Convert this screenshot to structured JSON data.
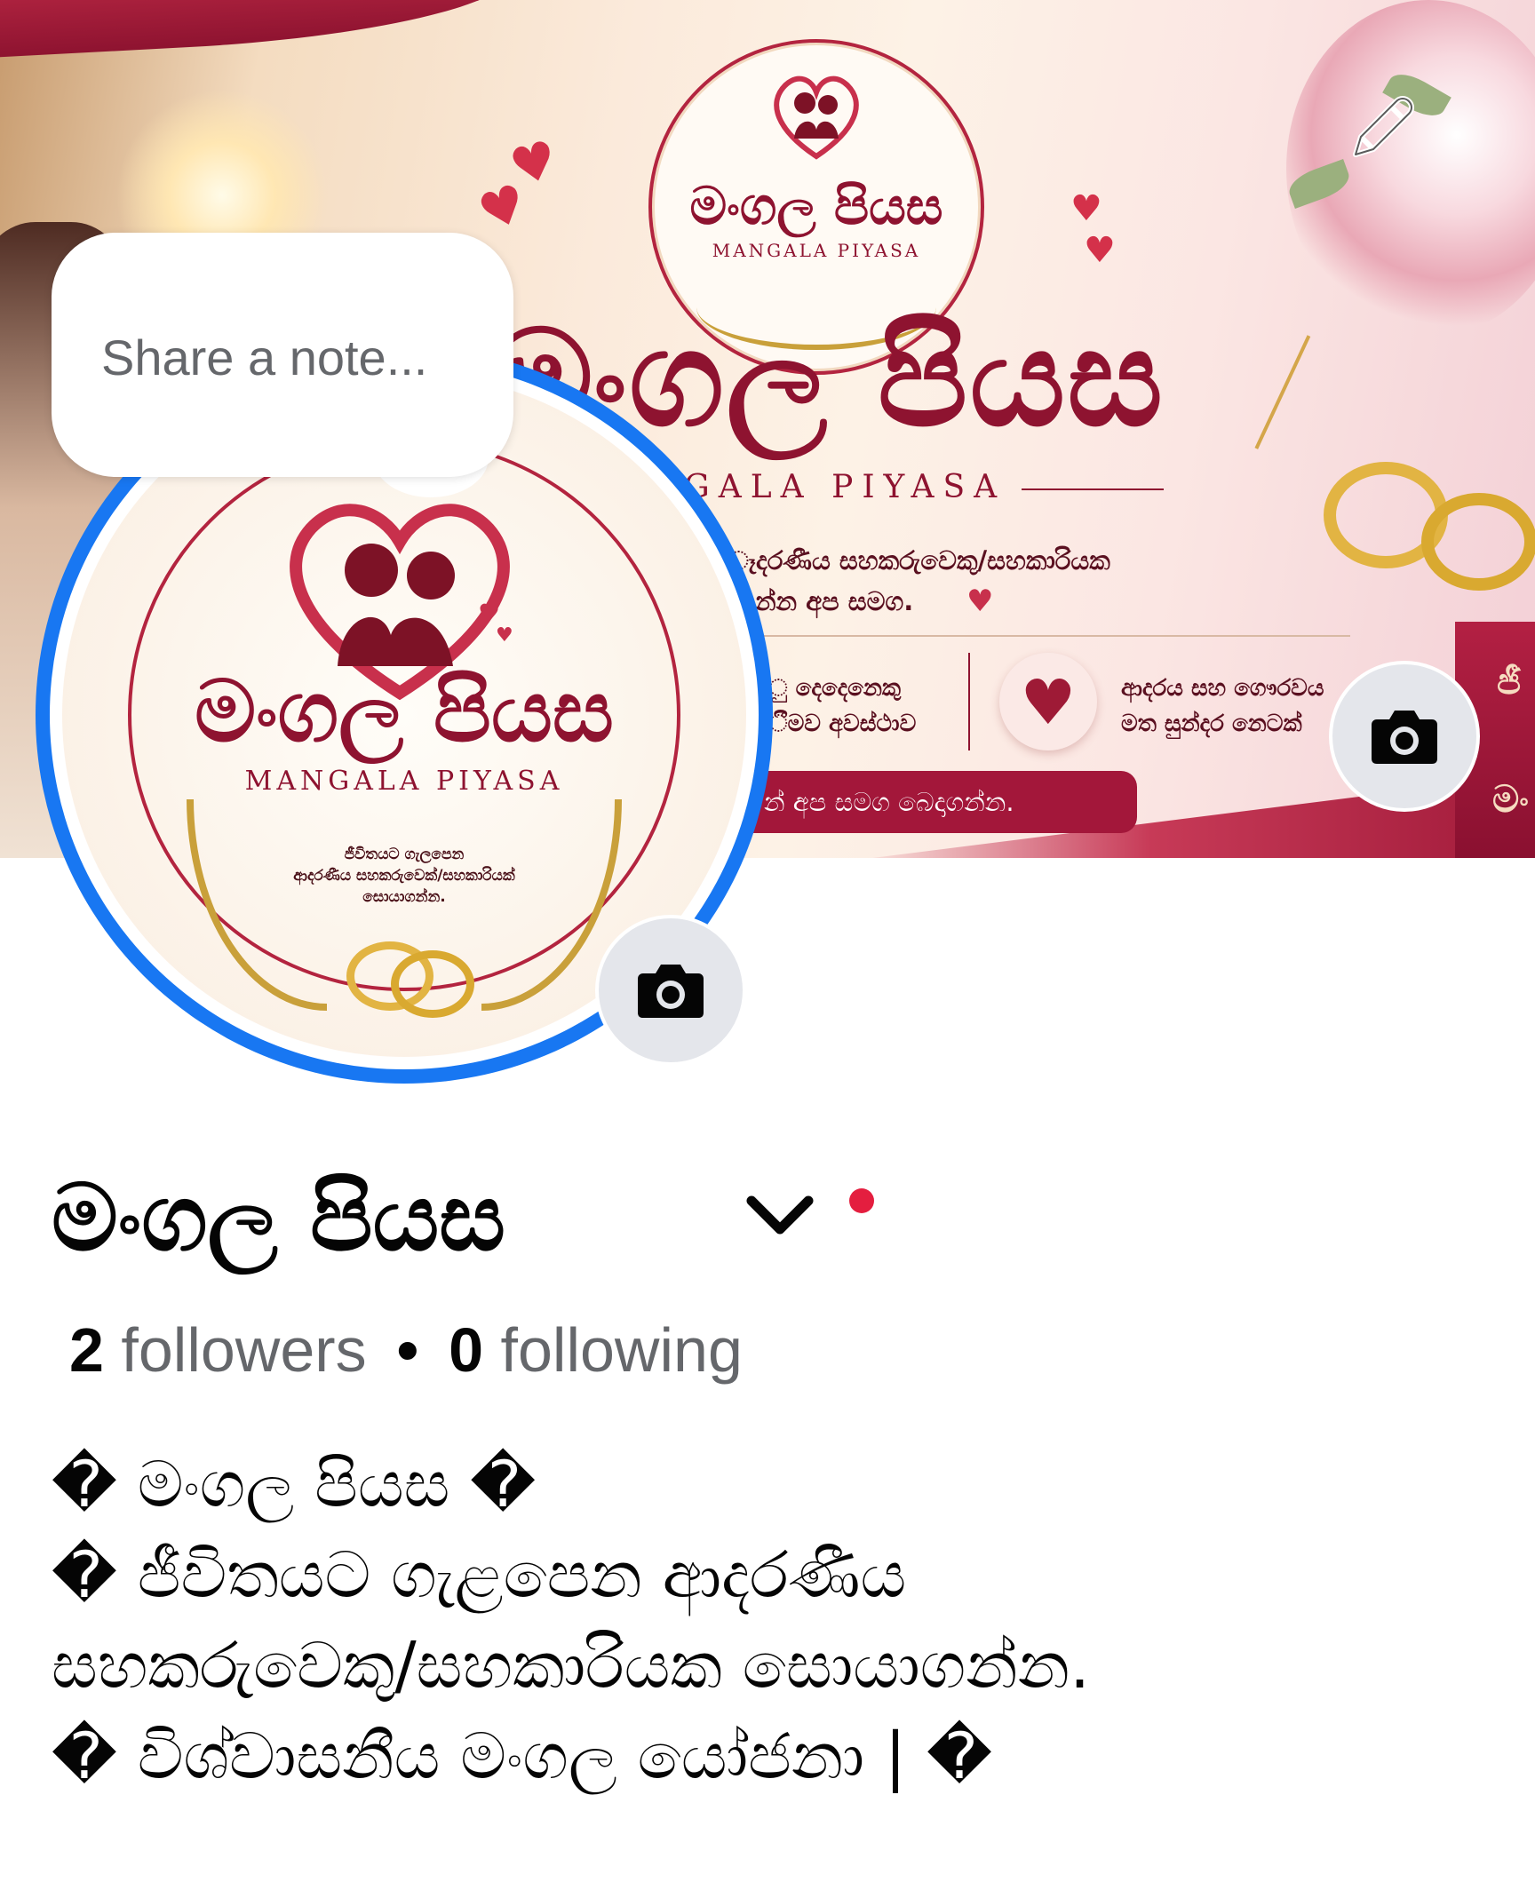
{
  "cover": {
    "title": "මංගල පියස",
    "subtitle": "GALA PIYASA",
    "line1": "ෑදරණීය සහකරුවෙකු/සහකාරියක",
    "line2": "න්න අප සමග.",
    "feature_left_1": "ු දෙදෙනෙකු",
    "feature_left_2": "ීමව අවස්ථාව",
    "feature_right_1": "ආදරය සහ ගෞරවය",
    "feature_right_2": "මත සුන්දර නෙටක්",
    "cta": "න් අප සමග බෙදාගන්න.",
    "side_text": "ජී",
    "side_text_2": "මං"
  },
  "cover_emblem": {
    "title": "මංගල පියස",
    "subtitle": "MANGALA PIYASA"
  },
  "avatar": {
    "title": "මංගල පියස",
    "subtitle": "MANGALA PIYASA",
    "tagline": "ජීවිතයට ගැලපෙන\nආදරණීය සහකරුවෙක්/සහකාරියක්\nසොයාගන්න."
  },
  "note": {
    "placeholder": "Share a note..."
  },
  "profile": {
    "name": "මංගල පියස",
    "followers_count": "2",
    "followers_label": "followers",
    "separator": "•",
    "following_count": "0",
    "following_label": "following",
    "bio": "� මංගල පියස �\n� ජීවිතයට ගැළපෙන ආදරණීය\nසහකරුවෙකු/සහකාරියක සොයාගන්න.\n� විශ්වාසනීය මංගල යෝජනා | �"
  },
  "colors": {
    "accent": "#1877f2",
    "brand_maroon": "#8e1330",
    "notification": "#e41e3f",
    "button_gray": "#e4e6eb",
    "secondary_text": "#65676b"
  },
  "icons": {
    "edit_cover": "pencil-icon",
    "cover_camera": "camera-icon",
    "avatar_camera": "camera-icon",
    "name_menu": "chevron-down-icon"
  }
}
